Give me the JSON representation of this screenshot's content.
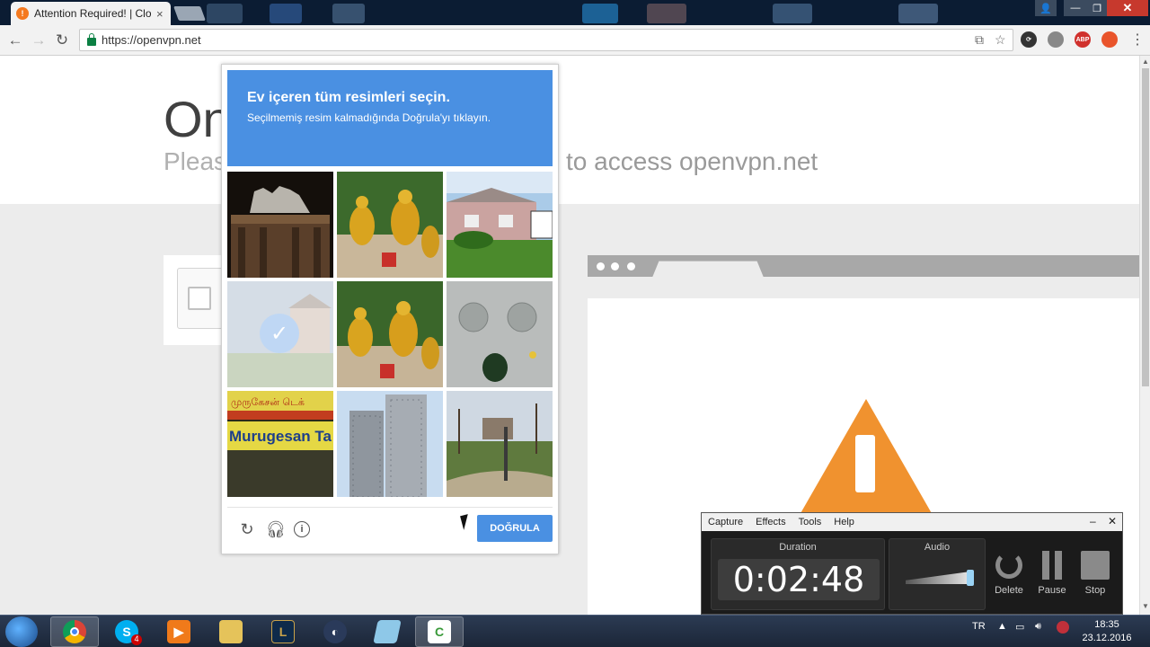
{
  "browser": {
    "tab_title": "Attention Required! | Clo",
    "tab_close": "×",
    "url": "https://openvpn.net",
    "window_controls": {
      "minimize": "—",
      "maximize": "❐",
      "close": "✕"
    }
  },
  "page": {
    "heading": "On",
    "subtitle_left": "Pleas",
    "subtitle_right": "to access openvpn.net"
  },
  "captcha": {
    "title": "Ev içeren tüm resimleri seçin.",
    "instruction": "Seçilmemiş resim kalmadığında Doğrula'yı tıklayın.",
    "verify_label": "DOĞRULA",
    "tiles": [
      {
        "name": "tile-1",
        "selected": false
      },
      {
        "name": "tile-2",
        "selected": false
      },
      {
        "name": "tile-3",
        "selected": false
      },
      {
        "name": "tile-4",
        "selected": true
      },
      {
        "name": "tile-5",
        "selected": false
      },
      {
        "name": "tile-6",
        "selected": false
      },
      {
        "name": "tile-7",
        "selected": false,
        "sign_text_top": "முருகேசன் டெக்",
        "sign_text": "Murugesan Ta"
      },
      {
        "name": "tile-8",
        "selected": false
      },
      {
        "name": "tile-9",
        "selected": false
      }
    ],
    "accent_color": "#4a90e2"
  },
  "recorder": {
    "menu": [
      "Capture",
      "Effects",
      "Tools",
      "Help"
    ],
    "minimize": "–",
    "close": "✕",
    "duration_label": "Duration",
    "duration_value": "0:02:48",
    "audio_label": "Audio",
    "buttons": {
      "delete": "Delete",
      "pause": "Pause",
      "stop": "Stop"
    }
  },
  "taskbar": {
    "lang": "TR",
    "time": "18:35",
    "date": "23.12.2016",
    "skype_badge": "4"
  }
}
